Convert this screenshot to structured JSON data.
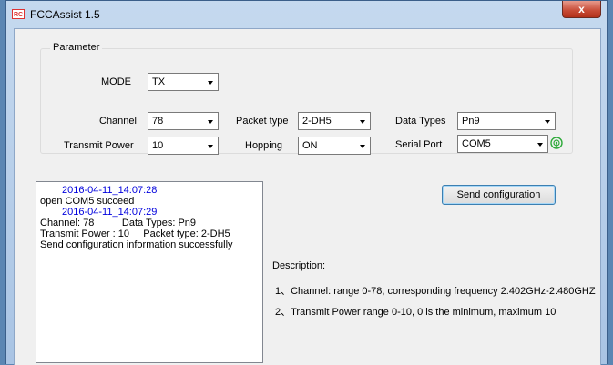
{
  "window": {
    "title": "FCCAssist 1.5",
    "icon_text": "RC",
    "close_glyph": "x"
  },
  "parameter": {
    "group_label": "Parameter",
    "mode": {
      "label": "MODE",
      "value": "TX"
    },
    "channel": {
      "label": "Channel",
      "value": "78"
    },
    "packet_type": {
      "label": "Packet type",
      "value": "2-DH5"
    },
    "data_types": {
      "label": "Data Types",
      "value": "Pn9"
    },
    "transmit_power": {
      "label": "Transmit Power",
      "value": "10"
    },
    "hopping": {
      "label": "Hopping",
      "value": "ON"
    },
    "serial_port": {
      "label": "Serial Port",
      "value": "COM5",
      "status_icon": "connected-signal-icon",
      "status_color": "#2eaa3a"
    }
  },
  "log": {
    "lines": [
      {
        "text": "2016-04-11_14:07:28",
        "kind": "timestamp"
      },
      {
        "text": "open COM5 succeed",
        "kind": "text"
      },
      {
        "text": "2016-04-11_14:07:29",
        "kind": "timestamp"
      },
      {
        "text": "Channel: 78          Data Types: Pn9",
        "kind": "text"
      },
      {
        "text": "Transmit Power : 10     Packet type: 2-DH5",
        "kind": "text"
      },
      {
        "text": "Send configuration information successfully",
        "kind": "text"
      }
    ]
  },
  "send_button": {
    "label": "Send configuration"
  },
  "description": {
    "title": "Description:",
    "items": [
      "1、Channel: range 0-78, corresponding frequency 2.402GHz-2.480GHZ",
      "2、Transmit Power  range 0-10, 0 is the minimum, maximum 10"
    ]
  },
  "colors": {
    "timestamp": "#0000dd",
    "titlebar": "#a9c4e4",
    "close_button": "#c74a35"
  }
}
